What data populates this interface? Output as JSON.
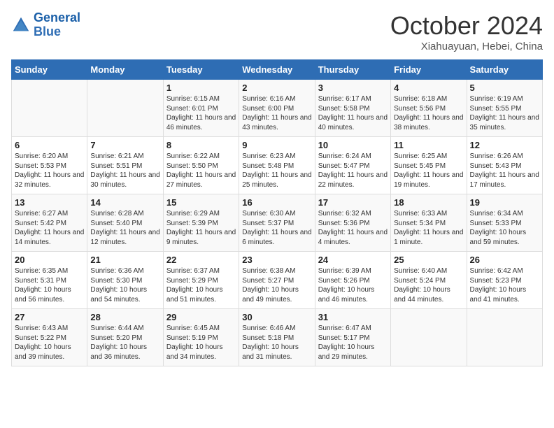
{
  "header": {
    "logo_line1": "General",
    "logo_line2": "Blue",
    "month": "October 2024",
    "location": "Xiahuayuan, Hebei, China"
  },
  "weekdays": [
    "Sunday",
    "Monday",
    "Tuesday",
    "Wednesday",
    "Thursday",
    "Friday",
    "Saturday"
  ],
  "weeks": [
    [
      {
        "day": "",
        "content": ""
      },
      {
        "day": "",
        "content": ""
      },
      {
        "day": "1",
        "content": "Sunrise: 6:15 AM\nSunset: 6:01 PM\nDaylight: 11 hours and 46 minutes."
      },
      {
        "day": "2",
        "content": "Sunrise: 6:16 AM\nSunset: 6:00 PM\nDaylight: 11 hours and 43 minutes."
      },
      {
        "day": "3",
        "content": "Sunrise: 6:17 AM\nSunset: 5:58 PM\nDaylight: 11 hours and 40 minutes."
      },
      {
        "day": "4",
        "content": "Sunrise: 6:18 AM\nSunset: 5:56 PM\nDaylight: 11 hours and 38 minutes."
      },
      {
        "day": "5",
        "content": "Sunrise: 6:19 AM\nSunset: 5:55 PM\nDaylight: 11 hours and 35 minutes."
      }
    ],
    [
      {
        "day": "6",
        "content": "Sunrise: 6:20 AM\nSunset: 5:53 PM\nDaylight: 11 hours and 32 minutes."
      },
      {
        "day": "7",
        "content": "Sunrise: 6:21 AM\nSunset: 5:51 PM\nDaylight: 11 hours and 30 minutes."
      },
      {
        "day": "8",
        "content": "Sunrise: 6:22 AM\nSunset: 5:50 PM\nDaylight: 11 hours and 27 minutes."
      },
      {
        "day": "9",
        "content": "Sunrise: 6:23 AM\nSunset: 5:48 PM\nDaylight: 11 hours and 25 minutes."
      },
      {
        "day": "10",
        "content": "Sunrise: 6:24 AM\nSunset: 5:47 PM\nDaylight: 11 hours and 22 minutes."
      },
      {
        "day": "11",
        "content": "Sunrise: 6:25 AM\nSunset: 5:45 PM\nDaylight: 11 hours and 19 minutes."
      },
      {
        "day": "12",
        "content": "Sunrise: 6:26 AM\nSunset: 5:43 PM\nDaylight: 11 hours and 17 minutes."
      }
    ],
    [
      {
        "day": "13",
        "content": "Sunrise: 6:27 AM\nSunset: 5:42 PM\nDaylight: 11 hours and 14 minutes."
      },
      {
        "day": "14",
        "content": "Sunrise: 6:28 AM\nSunset: 5:40 PM\nDaylight: 11 hours and 12 minutes."
      },
      {
        "day": "15",
        "content": "Sunrise: 6:29 AM\nSunset: 5:39 PM\nDaylight: 11 hours and 9 minutes."
      },
      {
        "day": "16",
        "content": "Sunrise: 6:30 AM\nSunset: 5:37 PM\nDaylight: 11 hours and 6 minutes."
      },
      {
        "day": "17",
        "content": "Sunrise: 6:32 AM\nSunset: 5:36 PM\nDaylight: 11 hours and 4 minutes."
      },
      {
        "day": "18",
        "content": "Sunrise: 6:33 AM\nSunset: 5:34 PM\nDaylight: 11 hours and 1 minute."
      },
      {
        "day": "19",
        "content": "Sunrise: 6:34 AM\nSunset: 5:33 PM\nDaylight: 10 hours and 59 minutes."
      }
    ],
    [
      {
        "day": "20",
        "content": "Sunrise: 6:35 AM\nSunset: 5:31 PM\nDaylight: 10 hours and 56 minutes."
      },
      {
        "day": "21",
        "content": "Sunrise: 6:36 AM\nSunset: 5:30 PM\nDaylight: 10 hours and 54 minutes."
      },
      {
        "day": "22",
        "content": "Sunrise: 6:37 AM\nSunset: 5:29 PM\nDaylight: 10 hours and 51 minutes."
      },
      {
        "day": "23",
        "content": "Sunrise: 6:38 AM\nSunset: 5:27 PM\nDaylight: 10 hours and 49 minutes."
      },
      {
        "day": "24",
        "content": "Sunrise: 6:39 AM\nSunset: 5:26 PM\nDaylight: 10 hours and 46 minutes."
      },
      {
        "day": "25",
        "content": "Sunrise: 6:40 AM\nSunset: 5:24 PM\nDaylight: 10 hours and 44 minutes."
      },
      {
        "day": "26",
        "content": "Sunrise: 6:42 AM\nSunset: 5:23 PM\nDaylight: 10 hours and 41 minutes."
      }
    ],
    [
      {
        "day": "27",
        "content": "Sunrise: 6:43 AM\nSunset: 5:22 PM\nDaylight: 10 hours and 39 minutes."
      },
      {
        "day": "28",
        "content": "Sunrise: 6:44 AM\nSunset: 5:20 PM\nDaylight: 10 hours and 36 minutes."
      },
      {
        "day": "29",
        "content": "Sunrise: 6:45 AM\nSunset: 5:19 PM\nDaylight: 10 hours and 34 minutes."
      },
      {
        "day": "30",
        "content": "Sunrise: 6:46 AM\nSunset: 5:18 PM\nDaylight: 10 hours and 31 minutes."
      },
      {
        "day": "31",
        "content": "Sunrise: 6:47 AM\nSunset: 5:17 PM\nDaylight: 10 hours and 29 minutes."
      },
      {
        "day": "",
        "content": ""
      },
      {
        "day": "",
        "content": ""
      }
    ]
  ]
}
